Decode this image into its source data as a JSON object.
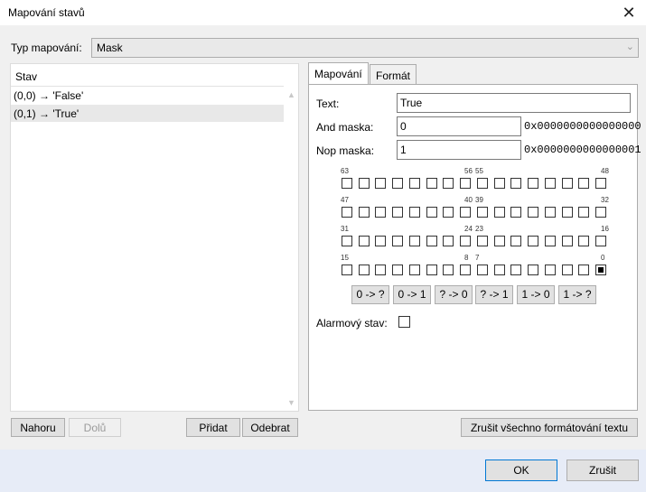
{
  "window": {
    "title": "Mapování stavů",
    "close_glyph": "✕"
  },
  "mapping_type": {
    "label": "Typ mapování:",
    "value": "Mask"
  },
  "states_list": {
    "header": "Stav",
    "rows": [
      "(0,0) → 'False'",
      "(0,1) → 'True'"
    ],
    "selected_index": 1
  },
  "left_buttons": {
    "up": "Nahoru",
    "down": "Dolů",
    "add": "Přidat",
    "remove": "Odebrat"
  },
  "tabs": [
    "Mapování",
    "Formát"
  ],
  "active_tab": 0,
  "mapping": {
    "text_label": "Text:",
    "text_value": "True",
    "and_label": "And maska:",
    "and_value": "0",
    "and_hex": "0x0000000000000000",
    "nop_label": "Nop maska:",
    "nop_value": "1",
    "nop_hex": "0x0000000000000001",
    "bit_labels": [
      [
        "63",
        "56",
        "55",
        "48"
      ],
      [
        "47",
        "40",
        "39",
        "32"
      ],
      [
        "31",
        "24",
        "23",
        "16"
      ],
      [
        "15",
        "8",
        "7",
        "0"
      ]
    ],
    "set_bits": [
      0
    ],
    "op_buttons": [
      "0 -> ?",
      "0 -> 1",
      "? -> 0",
      "? -> 1",
      "1 -> 0",
      "1 -> ?"
    ],
    "alarm_label": "Alarmový stav:",
    "alarm_checked": false
  },
  "clear_format_button": "Zrušit všechno formátování textu",
  "footer": {
    "ok": "OK",
    "cancel": "Zrušit"
  }
}
